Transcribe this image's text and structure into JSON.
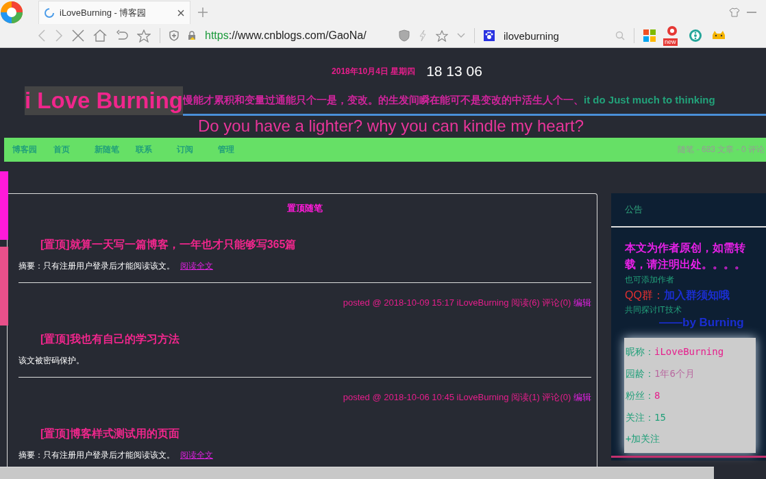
{
  "browser": {
    "tab_title": "iLoveBurning - 博客园",
    "url_scheme": "https",
    "url_rest": "://www.cnblogs.com/GaoNa/",
    "search_text": "iloveburning",
    "badge": "new"
  },
  "header": {
    "date": "2018年10月4日 星期四",
    "time": "18 13 06",
    "title": "i Love Burning",
    "marquee_cn": "慢能才累积和变量过通能只个一是，变改。的生发间瞬在能可不是变改的中活生人个一、",
    "marquee_en": "it do Just much to thinking",
    "subtitle": "Do you have a lighter? why you can kindle my heart?"
  },
  "nav": {
    "items": [
      {
        "label": "博客园"
      },
      {
        "label": "首页"
      },
      {
        "label": "新随笔"
      },
      {
        "label": "联系"
      },
      {
        "label": "订阅"
      },
      {
        "label": "管理"
      }
    ],
    "stats": "随笔 - 683  文章 - 0  评论"
  },
  "pinned": {
    "heading": "置顶随笔",
    "posts": [
      {
        "title": "[置顶]就算一天写一篇博客，一年也才只能够写365篇",
        "summary": "摘要：只有注册用户登录后才能阅读该文。",
        "link": "阅读全文",
        "meta": "posted @ 2018-10-09 15:17 iLoveBurning 阅读(6) 评论(0)",
        "edit": "编辑"
      },
      {
        "title": "[置顶]我也有自己的学习方法",
        "summary": "该文被密码保护。",
        "meta": "posted @ 2018-10-06 10:45 iLoveBurning 阅读(1) 评论(0)",
        "edit": "编辑"
      },
      {
        "title": "[置顶]博客样式测试用的页面",
        "summary": "摘要：只有注册用户登录后才能阅读该文。",
        "link": "阅读全文"
      }
    ]
  },
  "sidebar": {
    "heading": "公告",
    "notice": "本文为作者原创，如需转载，请注明出处。。。。",
    "add_author": "也可添加作者",
    "qq_label": "QQ群：",
    "qq_link": "加入群须知哦",
    "topic": "共同探讨IT技术",
    "signature": "——by Burning",
    "profile": [
      {
        "label": "昵称：",
        "value": "iLoveBurning"
      },
      {
        "label": "园龄：",
        "value": "1年6个月"
      },
      {
        "label": "粉丝：",
        "value": "8"
      },
      {
        "label": "关注：",
        "value": "15"
      }
    ],
    "follow": "+加关注"
  }
}
